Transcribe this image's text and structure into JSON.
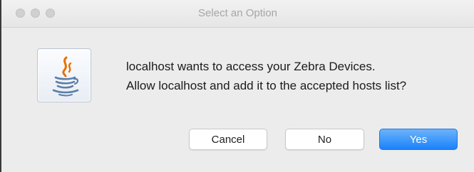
{
  "window": {
    "title": "Select an Option"
  },
  "dialog": {
    "icon": "java-coffee-cup-icon",
    "message_line1": "localhost wants to access your Zebra Devices.",
    "message_line2": "Allow localhost and add it to the accepted hosts list?"
  },
  "buttons": {
    "cancel": "Cancel",
    "no": "No",
    "yes": "Yes"
  },
  "colors": {
    "accent": "#1a82fb",
    "java_blue": "#5a7ea8",
    "java_orange": "#e76f00"
  }
}
